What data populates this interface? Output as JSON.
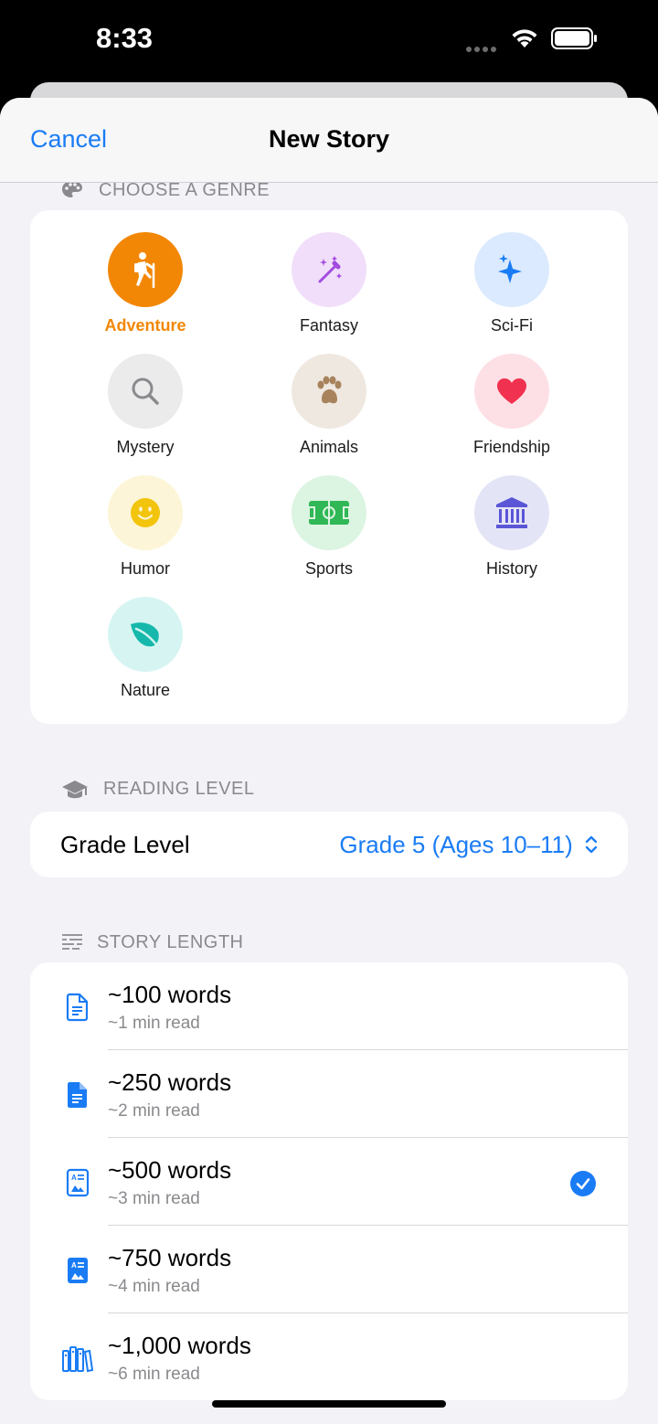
{
  "status": {
    "time": "8:33"
  },
  "nav": {
    "cancel": "Cancel",
    "title": "New Story"
  },
  "genre_section": {
    "header": "CHOOSE A GENRE",
    "genres": [
      {
        "label": "Adventure",
        "icon": "hiker-icon",
        "bg": "#f28705",
        "fg": "#ffffff",
        "selected": true
      },
      {
        "label": "Fantasy",
        "icon": "magic-wand-icon",
        "bg": "#f1defa",
        "fg": "#a24be0"
      },
      {
        "label": "Sci-Fi",
        "icon": "sparkles-icon",
        "bg": "#dbeafe",
        "fg": "#1a7cf5"
      },
      {
        "label": "Mystery",
        "icon": "magnifying-glass-icon",
        "bg": "#ebebeb",
        "fg": "#8a8a8e"
      },
      {
        "label": "Animals",
        "icon": "paw-icon",
        "bg": "#efe8e0",
        "fg": "#a7825c"
      },
      {
        "label": "Friendship",
        "icon": "heart-icon",
        "bg": "#fde0e6",
        "fg": "#f0314f"
      },
      {
        "label": "Humor",
        "icon": "smiley-icon",
        "bg": "#fdf5d7",
        "fg": "#f2c40c"
      },
      {
        "label": "Sports",
        "icon": "soccer-field-icon",
        "bg": "#dcf4e2",
        "fg": "#2fb855"
      },
      {
        "label": "History",
        "icon": "building-columns-icon",
        "bg": "#e4e4f7",
        "fg": "#5a56d6"
      },
      {
        "label": "Nature",
        "icon": "leaf-icon",
        "bg": "#d6f5f2",
        "fg": "#16b8ab"
      }
    ]
  },
  "reading_section": {
    "header": "READING LEVEL",
    "label": "Grade Level",
    "value": "Grade 5 (Ages 10–11)"
  },
  "length_section": {
    "header": "STORY LENGTH",
    "options": [
      {
        "words": "~100 words",
        "time": "~1 min read",
        "icon": "doc-outline-icon",
        "selected": false
      },
      {
        "words": "~250 words",
        "time": "~2 min read",
        "icon": "doc-filled-icon",
        "selected": false
      },
      {
        "words": "~500 words",
        "time": "~3 min read",
        "icon": "doc-richtext-outline-icon",
        "selected": true
      },
      {
        "words": "~750 words",
        "time": "~4 min read",
        "icon": "doc-richtext-filled-icon",
        "selected": false
      },
      {
        "words": "~1,000 words",
        "time": "~6 min read",
        "icon": "books-icon",
        "selected": false
      }
    ]
  },
  "colors": {
    "accent": "#1a7cf5",
    "selected_genre": "#f28705"
  }
}
